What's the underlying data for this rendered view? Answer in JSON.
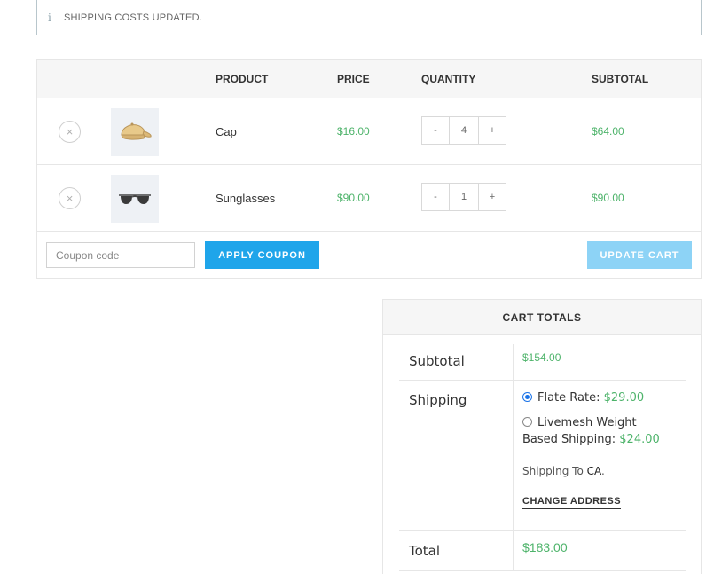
{
  "notice": {
    "icon": "info-icon",
    "text": "SHIPPING COSTS UPDATED."
  },
  "cart": {
    "headers": {
      "product": "PRODUCT",
      "price": "PRICE",
      "quantity": "QUANTITY",
      "subtotal": "SUBTOTAL"
    },
    "items": [
      {
        "name": "Cap",
        "price": "$16.00",
        "qty": "4",
        "subtotal": "$64.00",
        "thumb": "cap-image"
      },
      {
        "name": "Sunglasses",
        "price": "$90.00",
        "qty": "1",
        "subtotal": "$90.00",
        "thumb": "sunglasses-image"
      }
    ],
    "qty_minus": "-",
    "qty_plus": "+",
    "remove_glyph": "×",
    "coupon_placeholder": "Coupon code",
    "apply_label": "APPLY COUPON",
    "update_label": "UPDATE CART"
  },
  "totals": {
    "title": "CART TOTALS",
    "subtotal_label": "Subtotal",
    "subtotal_value": "$154.00",
    "shipping_label": "Shipping",
    "options": [
      {
        "name": "Flate Rate:",
        "price": "$29.00",
        "selected": true
      },
      {
        "name_line1": "Livemesh Weight",
        "name_line2": "Based Shipping:",
        "price": "$24.00",
        "selected": false
      }
    ],
    "shipping_to_prefix": "Shipping To",
    "shipping_to_value": "CA",
    "shipping_to_suffix": ".",
    "change_address": "CHANGE ADDRESS",
    "total_label": "Total",
    "total_value": "$183.00"
  },
  "colors": {
    "accent": "#1fa5ea",
    "accent_disabled": "#8dd3f6",
    "price_green": "#4db36a"
  }
}
